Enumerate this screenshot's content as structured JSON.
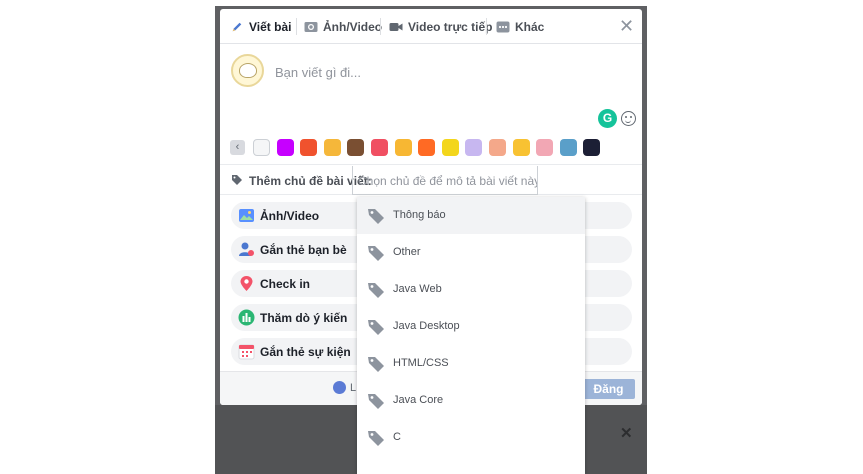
{
  "tabs": [
    {
      "label": "Viết bài",
      "icon": "pencil-icon",
      "active": true
    },
    {
      "label": "Ảnh/Video",
      "icon": "camera-icon",
      "active": false
    },
    {
      "label": "Video trực tiếp",
      "icon": "video-camera-icon",
      "active": false
    },
    {
      "label": "Khác",
      "icon": "more-dots-icon",
      "active": false
    }
  ],
  "composer": {
    "placeholder": "Bạn viết gì đi..."
  },
  "swatches": {
    "colors": [
      "#f5f6f7",
      "#c600ff",
      "#f0522e",
      "#f5b73a",
      "#7a4f32",
      "#f04f62",
      "#f7b733",
      "#ff6a24",
      "#f3d61c",
      "#c7b7f0",
      "#f4a88a",
      "#f8c232",
      "#f2a7b4",
      "#5a9fc9",
      "#1c1f35"
    ]
  },
  "topic": {
    "label": "Thêm chủ đề bài viết:",
    "input_placeholder": "Chọn chủ đề để mô tả bài viết này."
  },
  "actions": [
    {
      "label": "Ảnh/Video",
      "icon": "photo-icon"
    },
    {
      "label": "Gắn thẻ bạn bè",
      "icon": "tag-friend-icon"
    },
    {
      "label": "Check in",
      "icon": "location-pin-icon"
    },
    {
      "label": "Thăm dò ý kiến",
      "icon": "poll-icon"
    },
    {
      "label": "Gắn thẻ sự kiện",
      "icon": "calendar-icon"
    }
  ],
  "footer": {
    "privacy_label": "L",
    "post_label": "Đăng"
  },
  "dropdown": {
    "options": [
      "Thông báo",
      "Other",
      "Java Web",
      "Java Desktop",
      "HTML/CSS",
      "Java Core",
      "C"
    ],
    "highlighted_index": 0
  }
}
